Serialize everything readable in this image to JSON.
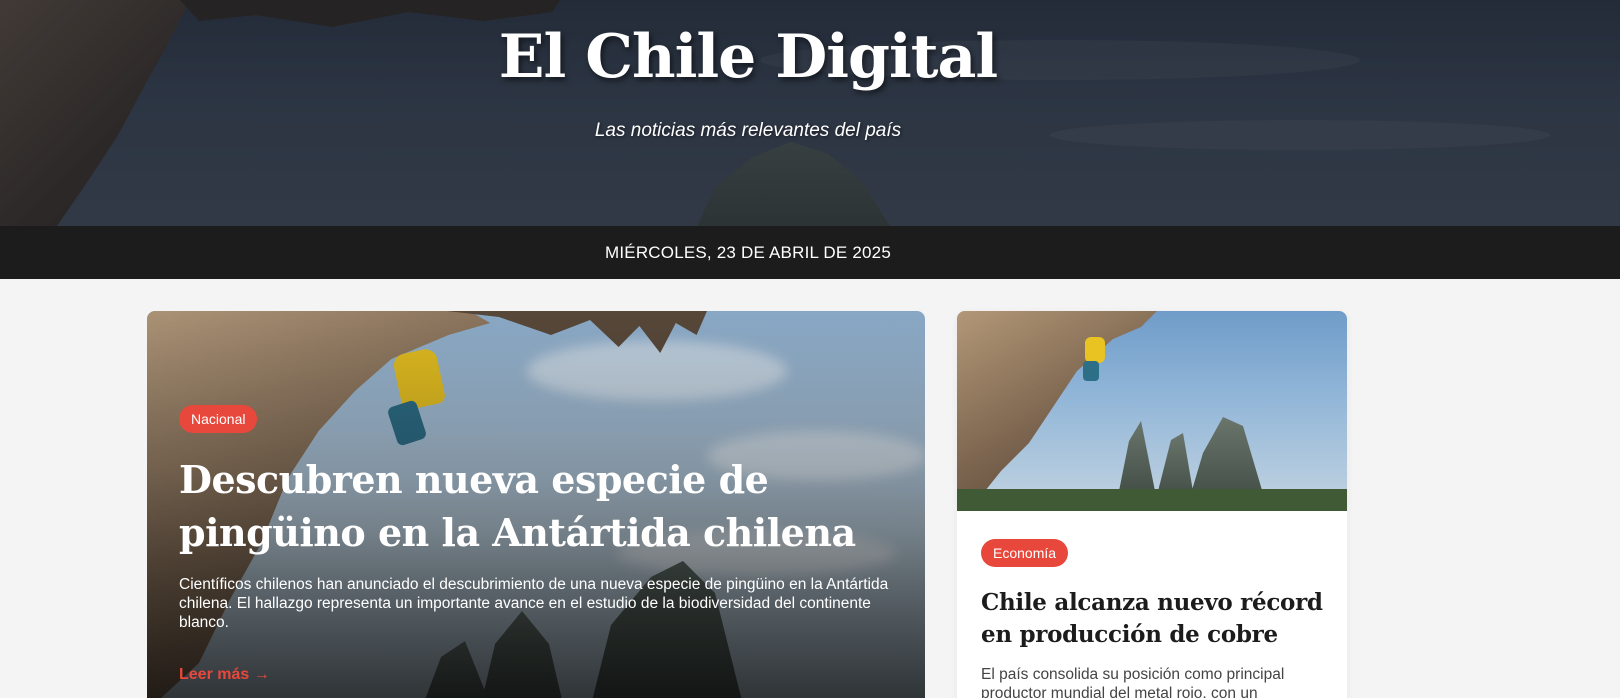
{
  "header": {
    "site_title": "El Chile Digital",
    "tagline": "Las noticias más relevantes del país"
  },
  "date_bar": {
    "date": "MIÉRCOLES, 23 DE ABRIL DE 2025"
  },
  "featured": {
    "category": "Nacional",
    "title": "Descubren nueva especie de pingüino en la Antártida chilena",
    "summary": "Científicos chilenos han anunciado el descubrimiento de una nueva especie de pingüino en la Antártida chilena. El hallazgo representa un importante avance en el estudio de la biodiversidad del continente blanco.",
    "read_more": "Leer más →"
  },
  "side_article": {
    "category": "Economía",
    "title": "Chile alcanza nuevo récord en producción de cobre",
    "summary": "El país consolida su posición como principal productor mundial del metal rojo, con un"
  },
  "colors": {
    "accent": "#e8483b",
    "date_bar_bg": "#1c1c1c",
    "page_bg": "#f4f4f4"
  }
}
